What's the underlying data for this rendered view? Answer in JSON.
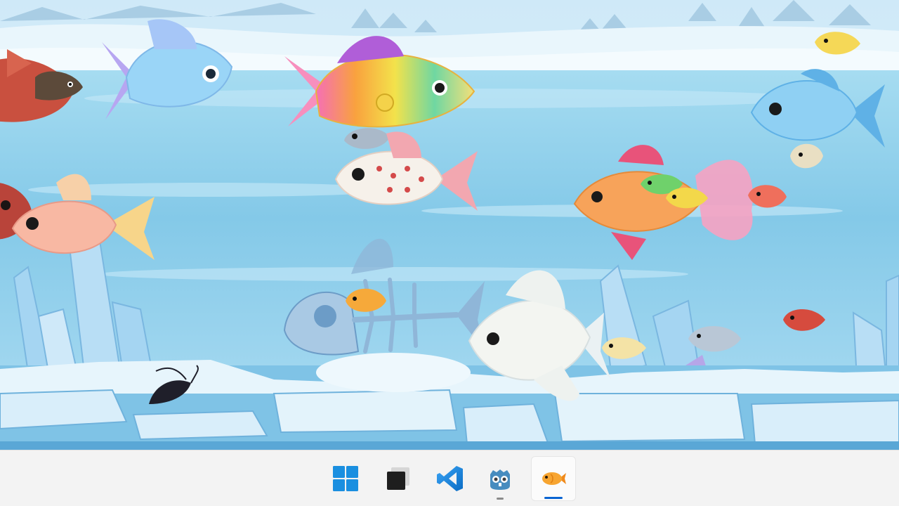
{
  "scene": {
    "colors": {
      "sky": "#d6eefa",
      "water": "#8fd0ec",
      "ice": "#e8f6fd",
      "crystal": "#a9d6f2"
    }
  },
  "taskbar": {
    "items": [
      {
        "icon": "windows-start-icon",
        "running": false,
        "active": false
      },
      {
        "icon": "terminal-window-icon",
        "running": false,
        "active": false
      },
      {
        "icon": "vscode-icon",
        "running": false,
        "active": false
      },
      {
        "icon": "godot-icon",
        "running": true,
        "active": false
      },
      {
        "icon": "fish-app-icon",
        "running": true,
        "active": true
      }
    ]
  }
}
